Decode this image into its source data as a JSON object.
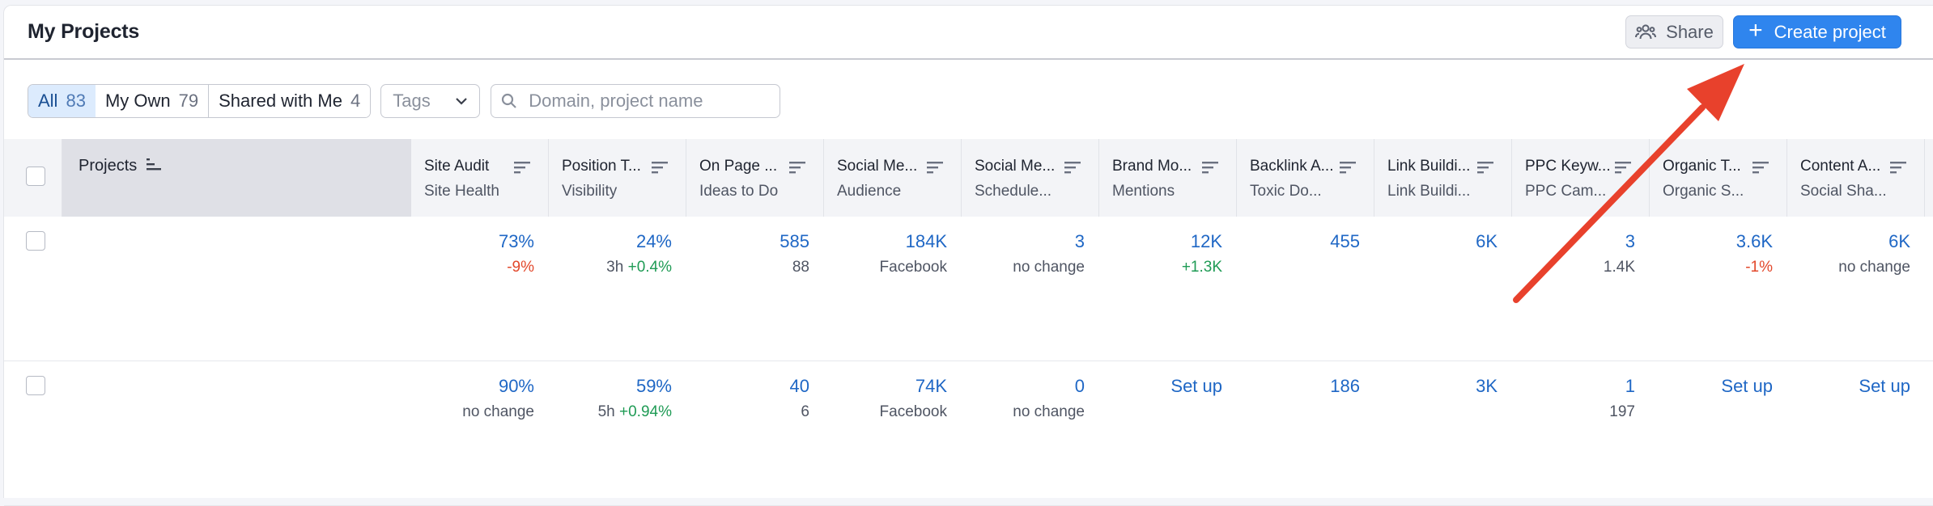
{
  "header": {
    "title": "My Projects",
    "share_label": "Share",
    "create_label": "Create project"
  },
  "filters": {
    "segments": [
      {
        "label": "All",
        "count": "83",
        "active": true
      },
      {
        "label": "My Own",
        "count": "79",
        "active": false
      },
      {
        "label": "Shared with Me",
        "count": "4",
        "active": false
      }
    ],
    "tags_label": "Tags",
    "search_placeholder": "Domain, project name"
  },
  "table": {
    "projects_header": "Projects",
    "columns": [
      {
        "title": "Site Audit",
        "metric": "Site Health"
      },
      {
        "title": "Position T...",
        "metric": "Visibility"
      },
      {
        "title": "On Page ...",
        "metric": "Ideas to Do"
      },
      {
        "title": "Social Me...",
        "metric": "Audience"
      },
      {
        "title": "Social Me...",
        "metric": "Schedule..."
      },
      {
        "title": "Brand Mo...",
        "metric": "Mentions"
      },
      {
        "title": "Backlink A...",
        "metric": "Toxic Do..."
      },
      {
        "title": "Link Buildi...",
        "metric": "Link Buildi..."
      },
      {
        "title": "PPC Keyw...",
        "metric": "PPC Cam..."
      },
      {
        "title": "Organic T...",
        "metric": "Organic S..."
      },
      {
        "title": "Content A...",
        "metric": "Social Sha..."
      }
    ],
    "rows": [
      {
        "cells": [
          {
            "value": "73%",
            "sub_prefix": "",
            "sub": "-9%",
            "sub_tone": "down"
          },
          {
            "value": "24%",
            "sub_prefix": "3h ",
            "sub": "+0.4%",
            "sub_tone": "up"
          },
          {
            "value": "585",
            "sub_prefix": "",
            "sub": "88",
            "sub_tone": "neutral"
          },
          {
            "value": "184K",
            "sub_prefix": "",
            "sub": "Facebook",
            "sub_tone": "neutral"
          },
          {
            "value": "3",
            "sub_prefix": "",
            "sub": "no change",
            "sub_tone": "neutral"
          },
          {
            "value": "12K",
            "sub_prefix": "",
            "sub": "+1.3K",
            "sub_tone": "up"
          },
          {
            "value": "455",
            "sub_prefix": "",
            "sub": "",
            "sub_tone": "neutral"
          },
          {
            "value": "6K",
            "sub_prefix": "",
            "sub": "",
            "sub_tone": "neutral"
          },
          {
            "value": "3",
            "sub_prefix": "",
            "sub": "1.4K",
            "sub_tone": "neutral"
          },
          {
            "value": "3.6K",
            "sub_prefix": "",
            "sub": "-1%",
            "sub_tone": "down"
          },
          {
            "value": "6K",
            "sub_prefix": "",
            "sub": "no change",
            "sub_tone": "neutral"
          }
        ]
      },
      {
        "cells": [
          {
            "value": "90%",
            "sub_prefix": "",
            "sub": "no change",
            "sub_tone": "neutral"
          },
          {
            "value": "59%",
            "sub_prefix": "5h ",
            "sub": "+0.94%",
            "sub_tone": "up"
          },
          {
            "value": "40",
            "sub_prefix": "",
            "sub": "6",
            "sub_tone": "neutral"
          },
          {
            "value": "74K",
            "sub_prefix": "",
            "sub": "Facebook",
            "sub_tone": "neutral"
          },
          {
            "value": "0",
            "sub_prefix": "",
            "sub": "no change",
            "sub_tone": "neutral"
          },
          {
            "value": "Set up",
            "sub_prefix": "",
            "sub": "",
            "sub_tone": "neutral"
          },
          {
            "value": "186",
            "sub_prefix": "",
            "sub": "",
            "sub_tone": "neutral"
          },
          {
            "value": "3K",
            "sub_prefix": "",
            "sub": "",
            "sub_tone": "neutral"
          },
          {
            "value": "1",
            "sub_prefix": "",
            "sub": "197",
            "sub_tone": "neutral"
          },
          {
            "value": "Set up",
            "sub_prefix": "",
            "sub": "",
            "sub_tone": "neutral"
          },
          {
            "value": "Set up",
            "sub_prefix": "",
            "sub": "",
            "sub_tone": "neutral"
          }
        ]
      }
    ]
  },
  "colors": {
    "accent": "#2f85ee",
    "link": "#1f67c5",
    "positive": "#1f9b55",
    "negative": "#e2482b",
    "annotation_arrow": "#e8412c"
  },
  "annotation": {
    "icon": "red-arrow-icon",
    "points_to": "create-project-button"
  }
}
